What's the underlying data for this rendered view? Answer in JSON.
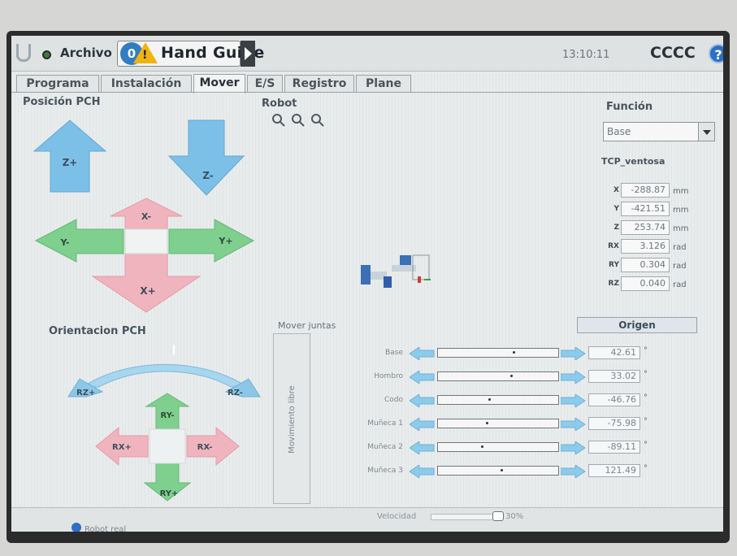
{
  "header": {
    "file_menu": "Archivo",
    "mode_number": "0",
    "mode_label": "Hand Guide",
    "clock": "13:10:11",
    "robot_name": "CCCC"
  },
  "tabs": [
    {
      "label": "Programa",
      "active": false
    },
    {
      "label": "Instalación",
      "active": false
    },
    {
      "label": "Mover",
      "active": true
    },
    {
      "label": "E/S",
      "active": false
    },
    {
      "label": "Registro",
      "active": false
    },
    {
      "label": "Plane",
      "active": false
    }
  ],
  "position_panel": {
    "title": "Posición PCH",
    "arrows": {
      "z_plus": "Z+",
      "z_minus": "Z-",
      "x_minus": "X-",
      "x_plus": "X+",
      "y_minus": "Y-",
      "y_plus": "Y+"
    }
  },
  "orientation_panel": {
    "title": "Orientacion PCH",
    "arrows": {
      "rz_plus": "RZ+",
      "rz_minus": "RZ-",
      "ry_minus": "RY-",
      "ry_plus": "RY+",
      "rx_plus": "RX+",
      "rx_minus": "RX-"
    }
  },
  "robot_view": {
    "title": "Robot",
    "zoom_icons": [
      "zoom-in-icon",
      "zoom-out-icon",
      "zoom-fit-icon"
    ]
  },
  "function_panel": {
    "title": "Función",
    "selected": "Base",
    "tcp_name": "TCP_ventosa",
    "fields": [
      {
        "label": "X",
        "value": "-288.87",
        "unit": "mm"
      },
      {
        "label": "Y",
        "value": "-421.51",
        "unit": "mm"
      },
      {
        "label": "Z",
        "value": "253.74",
        "unit": "mm"
      },
      {
        "label": "RX",
        "value": "3.126",
        "unit": "rad"
      },
      {
        "label": "RY",
        "value": "0.304",
        "unit": "rad"
      },
      {
        "label": "RZ",
        "value": "0.040",
        "unit": "rad"
      }
    ]
  },
  "origin_button": "Origen",
  "joints": {
    "title": "Mover juntas",
    "freedrive_label": "Movimiento libre",
    "items": [
      {
        "name": "Base",
        "value": "42.61",
        "unit": "°",
        "position": 0.62
      },
      {
        "name": "Hombro",
        "value": "33.02",
        "unit": "°",
        "position": 0.6
      },
      {
        "name": "Codo",
        "value": "-46.76",
        "unit": "°",
        "position": 0.42
      },
      {
        "name": "Muñeca 1",
        "value": "-75.98",
        "unit": "°",
        "position": 0.4
      },
      {
        "name": "Muñeca 2",
        "value": "-89.11",
        "unit": "°",
        "position": 0.36
      },
      {
        "name": "Muñeca 3",
        "value": "121.49",
        "unit": "°",
        "position": 0.52
      }
    ]
  },
  "footer": {
    "status": "Robot real",
    "speed_label": "Velocidad",
    "speed_pct": "30%",
    "speed": 0.3
  },
  "colors": {
    "blue_arrow": "#7cc0e8",
    "pink_arrow": "#f0b4bf",
    "green_arrow": "#7fcf8f",
    "accent_blue": "#2f7ec2",
    "warning_yellow": "#f2b30c"
  }
}
